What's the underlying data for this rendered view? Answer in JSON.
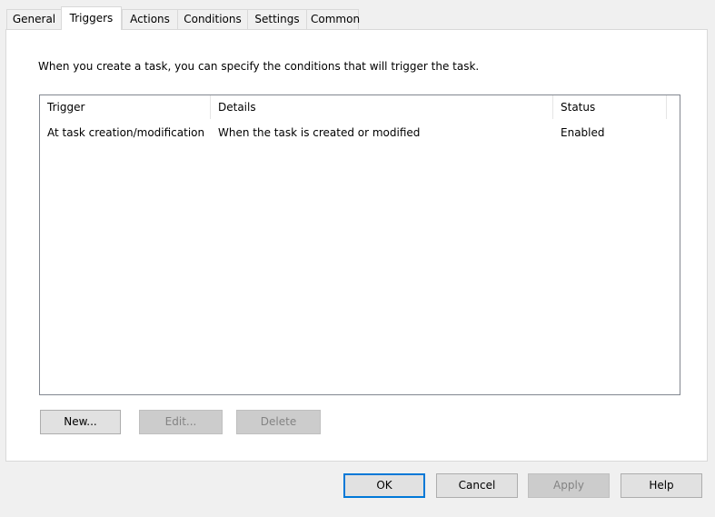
{
  "tabs": [
    {
      "label": "General"
    },
    {
      "label": "Triggers"
    },
    {
      "label": "Actions"
    },
    {
      "label": "Conditions"
    },
    {
      "label": "Settings"
    },
    {
      "label": "Common"
    }
  ],
  "active_tab": "Triggers",
  "description": "When you create a task, you can specify the conditions that will trigger the task.",
  "list": {
    "columns": [
      "Trigger",
      "Details",
      "Status"
    ],
    "rows": [
      {
        "trigger": "At task creation/modification",
        "details": "When the task is created or modified",
        "status": "Enabled"
      }
    ]
  },
  "list_buttons": {
    "new": "New...",
    "edit": "Edit...",
    "delete": "Delete"
  },
  "dialog_buttons": {
    "ok": "OK",
    "cancel": "Cancel",
    "apply": "Apply",
    "help": "Help"
  },
  "colors": {
    "accent": "#0078d7",
    "disabled_text": "#838383"
  }
}
